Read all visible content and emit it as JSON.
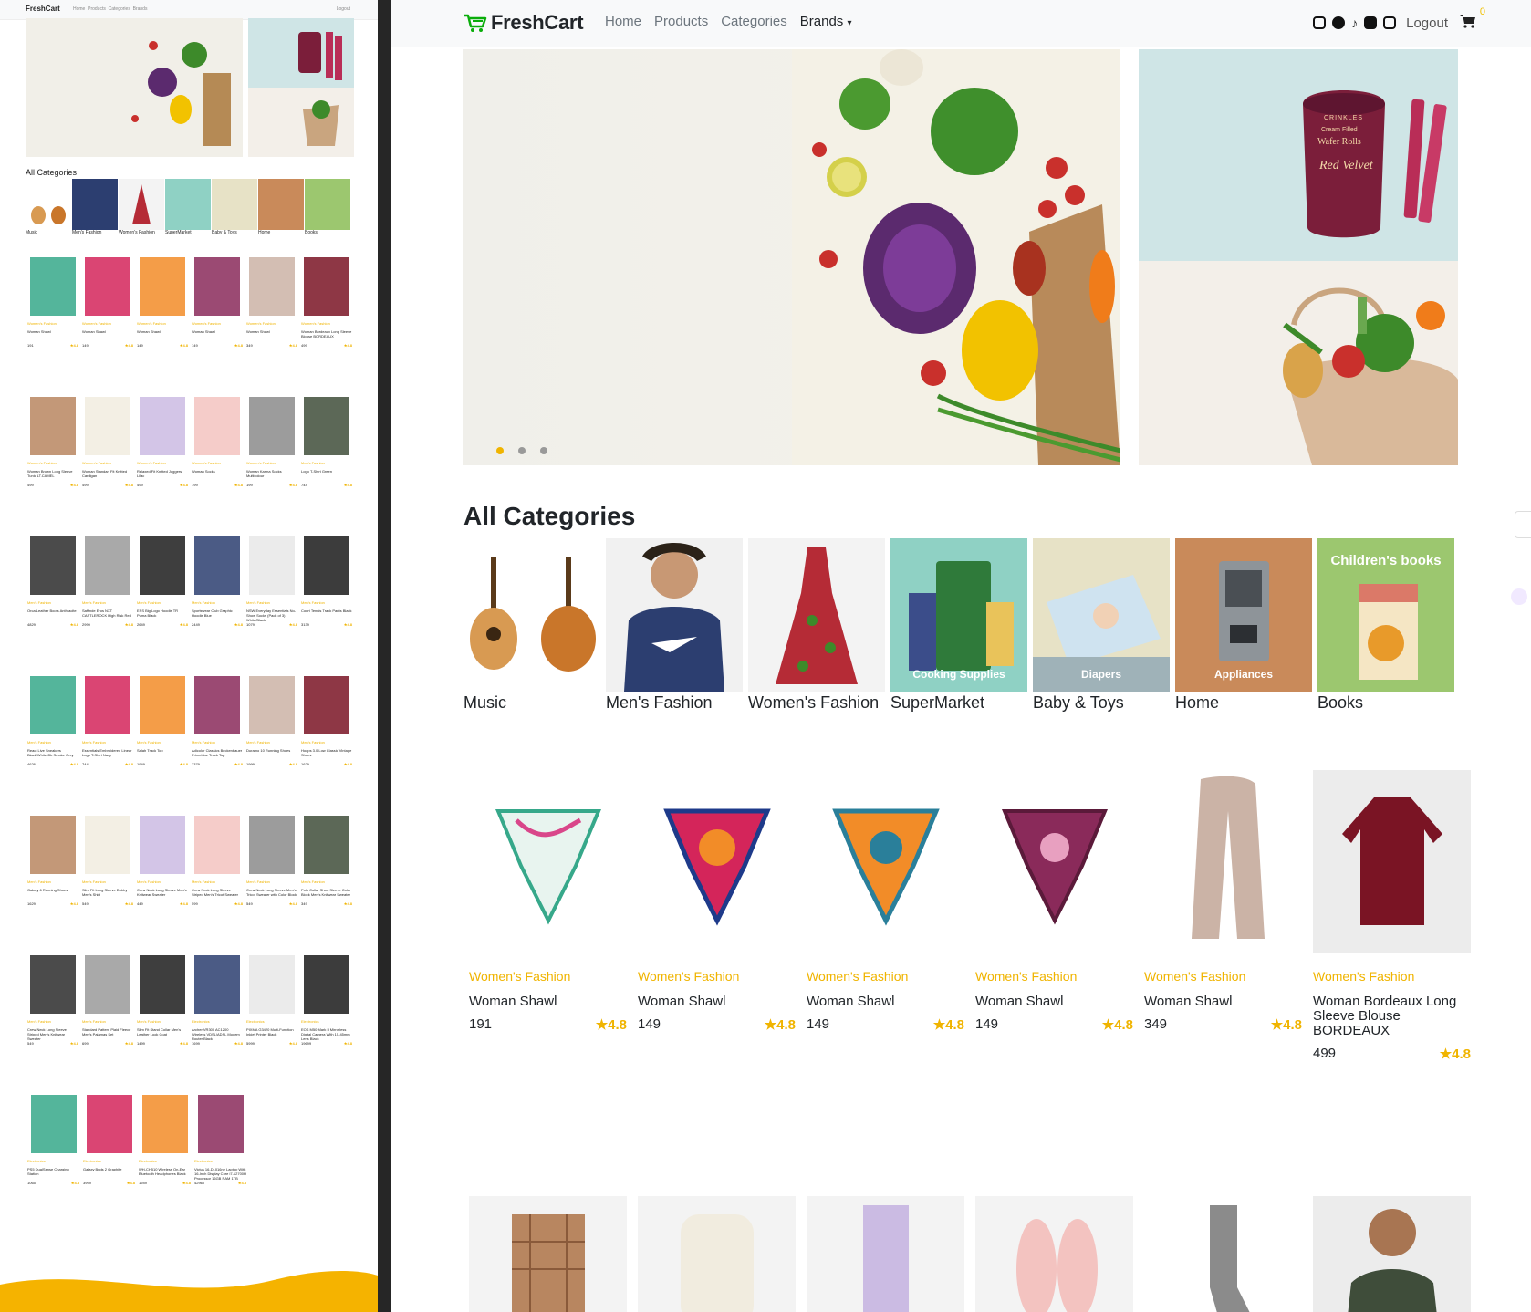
{
  "nav": {
    "brand": "FreshCart",
    "links": [
      "Home",
      "Products",
      "Categories"
    ],
    "brands_label": "Brands",
    "social_icons": [
      "instagram-icon",
      "facebook-icon",
      "tiktok-icon",
      "linkedin-icon",
      "youtube-icon"
    ],
    "logout": "Logout",
    "cart_count": "0"
  },
  "colors": {
    "accent": "#f0b400",
    "brand_green": "#0aad0a",
    "text": "#212529",
    "muted": "#6c757d"
  },
  "slider": {
    "main_promo": {
      "brand": "CRINKLES",
      "product_line_1": "Cream Filled",
      "product_line_2": "Wafer Rolls",
      "flavor": "Red Velvet"
    }
  },
  "categories": {
    "title": "All Categories",
    "items": [
      {
        "label": "Music",
        "overlay": ""
      },
      {
        "label": "Men's Fashion",
        "overlay": ""
      },
      {
        "label": "Women's Fashion",
        "overlay": ""
      },
      {
        "label": "SuperMarket",
        "overlay": "Cooking Supplies"
      },
      {
        "label": "Baby & Toys",
        "overlay": "Diapers"
      },
      {
        "label": "Home",
        "overlay": "Appliances"
      },
      {
        "label": "Books",
        "overlay": "Children's books"
      }
    ]
  },
  "products": [
    {
      "category": "Women's Fashion",
      "name": "Woman Shawl",
      "price": "191",
      "rating": "4.8"
    },
    {
      "category": "Women's Fashion",
      "name": "Woman Shawl",
      "price": "149",
      "rating": "4.8"
    },
    {
      "category": "Women's Fashion",
      "name": "Woman Shawl",
      "price": "149",
      "rating": "4.8"
    },
    {
      "category": "Women's Fashion",
      "name": "Woman Shawl",
      "price": "149",
      "rating": "4.8"
    },
    {
      "category": "Women's Fashion",
      "name": "Woman Shawl",
      "price": "349",
      "rating": "4.8"
    },
    {
      "category": "Women's Fashion",
      "name": "Woman Bordeaux Long Sleeve Blouse BORDEAUX",
      "price": "499",
      "rating": "4.8"
    }
  ],
  "preview": {
    "rows": [
      [
        {
          "c": "Women's Fashion",
          "n": "Woman Shawl",
          "p": "191",
          "r": "4.8"
        },
        {
          "c": "Women's Fashion",
          "n": "Woman Shawl",
          "p": "149",
          "r": "4.8"
        },
        {
          "c": "Women's Fashion",
          "n": "Woman Shawl",
          "p": "149",
          "r": "4.8"
        },
        {
          "c": "Women's Fashion",
          "n": "Woman Shawl",
          "p": "149",
          "r": "4.8"
        },
        {
          "c": "Women's Fashion",
          "n": "Woman Shawl",
          "p": "349",
          "r": "4.8"
        },
        {
          "c": "Women's Fashion",
          "n": "Woman Bordeaux Long Sleeve Blouse BORDEAUX",
          "p": "499",
          "r": "4.8"
        }
      ],
      [
        {
          "c": "Women's Fashion",
          "n": "Woman Brown Long Sleeve Tunic LT.CAMEL",
          "p": "499",
          "r": "4.8"
        },
        {
          "c": "Women's Fashion",
          "n": "Woman Standart Fit Knitted Cardigan",
          "p": "499",
          "r": "4.8"
        },
        {
          "c": "Women's Fashion",
          "n": "Relaxed Fit Knitted Joggers Lilac",
          "p": "499",
          "r": "4.8"
        },
        {
          "c": "Women's Fashion",
          "n": "Woman Socks",
          "p": "199",
          "r": "4.8"
        },
        {
          "c": "Women's Fashion",
          "n": "Woman Karma Socks Multicolour",
          "p": "199",
          "r": "4.8"
        },
        {
          "c": "Men's Fashion",
          "n": "Logo T-Shirt Green",
          "p": "744",
          "r": "4.8"
        }
      ],
      [
        {
          "c": "Men's Fashion",
          "n": "Orca Leather Boots Anthracite",
          "p": "4829",
          "r": "4.8"
        },
        {
          "c": "Men's Fashion",
          "n": "Saffinde Eros NXT CASTLEROCK High Risk Red",
          "p": "2999",
          "r": "4.8"
        },
        {
          "c": "Men's Fashion",
          "n": "ESS Big Logo Hoodie TR Puma Black",
          "p": "2649",
          "r": "4.8"
        },
        {
          "c": "Men's Fashion",
          "n": "Sportswear Club Graphic Hoodie Blue",
          "p": "2449",
          "r": "4.8"
        },
        {
          "c": "Men's Fashion",
          "n": "NSW Everyday Essentials No-Show Socks (Pack of 3) White/Black",
          "p": "1079",
          "r": "4.8"
        },
        {
          "c": "Men's Fashion",
          "n": "Court Tennis Track Pants Black",
          "p": "3139",
          "r": "4.8"
        }
      ],
      [
        {
          "c": "Men's Fashion",
          "n": "React Live Sneakers Black/White-Dk Smoke Grey",
          "p": "4626",
          "r": "4.8"
        },
        {
          "c": "Men's Fashion",
          "n": "Essentials Embroidered Linear Logo T-Shirt Navy",
          "p": "744",
          "r": "4.8"
        },
        {
          "c": "Men's Fashion",
          "n": "Salah Track Top",
          "p": "1949",
          "r": "4.8"
        },
        {
          "c": "Men's Fashion",
          "n": "Adicolor Classics Beckenbauer Primeblue Track Top",
          "p": "2379",
          "r": "4.8"
        },
        {
          "c": "Men's Fashion",
          "n": "Duramo 10 Running Shoes",
          "p": "1999",
          "r": "4.8"
        },
        {
          "c": "Men's Fashion",
          "n": "Hoops 3.0 Low Classic Vintage Shoes",
          "p": "1629",
          "r": "4.8"
        }
      ],
      [
        {
          "c": "Men's Fashion",
          "n": "Galaxy 6 Running Shoes",
          "p": "1629",
          "r": "4.8"
        },
        {
          "c": "Men's Fashion",
          "n": "Slim Fit Long Sleeve Dobby Men's Shirt",
          "p": "549",
          "r": "4.8"
        },
        {
          "c": "Men's Fashion",
          "n": "Crew Neck Long Sleeve Men's Knitwear Sweater",
          "p": "449",
          "r": "4.8"
        },
        {
          "c": "Men's Fashion",
          "n": "Crew Neck Long Sleeve Striped Men's Tricot Sweater",
          "p": "599",
          "r": "4.8"
        },
        {
          "c": "Men's Fashion",
          "n": "Crew Neck Long Sleeve Men's Tricot Sweater with Color Block",
          "p": "549",
          "r": "4.8"
        },
        {
          "c": "Men's Fashion",
          "n": "Polo Collar Short Sleeve Color Block Men's Knitwear Sweater",
          "p": "349",
          "r": "4.8"
        }
      ],
      [
        {
          "c": "Men's Fashion",
          "n": "Crew Neck Long Sleeve Striped Men's Knitwear Sweater",
          "p": "549",
          "r": "4.8"
        },
        {
          "c": "Men's Fashion",
          "n": "Standard Pattern Plaid Fleece Men's Pajamas Set",
          "p": "699",
          "r": "4.8"
        },
        {
          "c": "Men's Fashion",
          "n": "Slim Fit Stand Collar Men's Leather Look Coat",
          "p": "1499",
          "r": "4.8"
        },
        {
          "c": "Electronics",
          "n": "Archer VR300 AC1200 Wireless VDSL/ADSL Modem Router Black",
          "p": "1699",
          "r": "4.8"
        },
        {
          "c": "Electronics",
          "n": "PIXMA G3420 Multi-Function Inkjet Printer Black",
          "p": "5999",
          "r": "4.8"
        },
        {
          "c": "Electronics",
          "n": "EOS M50 Mark II Mirrorless Digital Camera With 15-45mm Lens Black",
          "p": "19699",
          "r": "4.8"
        }
      ],
      [
        {
          "c": "Electronics",
          "n": "PS5 DualSense Charging Station",
          "p": "1065",
          "r": "4.8"
        },
        {
          "c": "Electronics",
          "n": "Galaxy Buds 2 Graphite",
          "p": "3999",
          "r": "4.8"
        },
        {
          "c": "Electronics",
          "n": "WH-CH510 Wireless On-Ear Bluetooth Headphones Black",
          "p": "1949",
          "r": "4.8"
        },
        {
          "c": "Electronics",
          "n": "Victus 16-D1016ne Laptop With 16-Inch Display Core i7-12700H Processor 16GB RAM 1TB NVIDIA GeForce RTX3050 Ti Graphics English/Arabic Ceramic White",
          "p": "42960",
          "r": "4.8"
        }
      ]
    ]
  }
}
